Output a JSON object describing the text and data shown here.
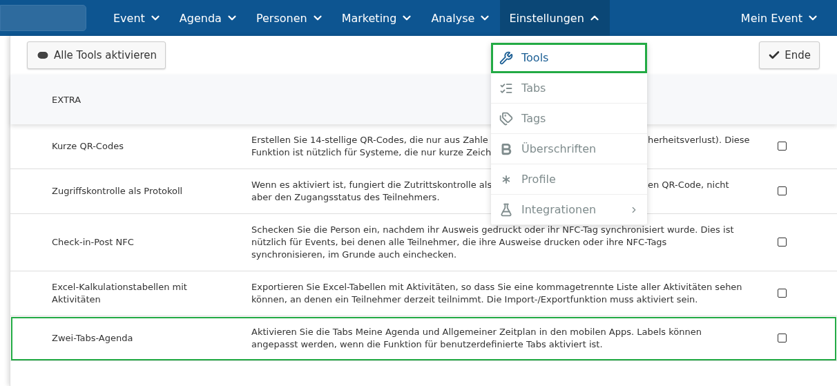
{
  "nav": {
    "items": [
      {
        "label": "Event",
        "expanded": false
      },
      {
        "label": "Agenda",
        "expanded": false
      },
      {
        "label": "Personen",
        "expanded": false
      },
      {
        "label": "Marketing",
        "expanded": false
      },
      {
        "label": "Analyse",
        "expanded": false
      },
      {
        "label": "Einstellungen",
        "expanded": true
      }
    ],
    "account": {
      "label": "Mein Event",
      "expanded": false
    }
  },
  "toolbar": {
    "enable_all": "Alle Tools aktivieren",
    "done": "Ende"
  },
  "table": {
    "section": "EXTRA",
    "rows": [
      {
        "name": "Kurze QR-Codes",
        "lines": [
          {
            "left": "Erstellen Sie 14-stellige QR-Codes, die nur aus Zahle",
            "right": "herheitsverlust). Diese"
          },
          {
            "left": "Funktion ist nützlich für Systeme, die nur kurze Zeich"
          }
        ],
        "checked": false,
        "highlighted": false
      },
      {
        "name": "Zugriffskontrolle als Protokoll",
        "lines": [
          {
            "left": "Wenn es aktiviert ist, fungiert die Zutrittskontrolle als",
            "right": "en QR-Code, nicht"
          },
          {
            "left": "aber den Zugangsstatus des Teilnehmers."
          }
        ],
        "checked": false,
        "highlighted": false
      },
      {
        "name": "Check-in-Post NFC",
        "description": "Schecken Sie die Person ein, nachdem ihr Ausweis gedruckt oder ihr NFC-Tag synchronisiert wurde. Dies ist nützlich für Events, bei denen alle Teilnehmer, die ihre Ausweise drucken oder ihre NFC-Tags synchronisieren, im Grunde auch einchecken.",
        "checked": false,
        "highlighted": false
      },
      {
        "name": "Excel-Kalkulationstabellen mit Aktivitäten",
        "description": "Exportieren Sie Excel-Tabellen mit Aktivitäten, so dass Sie eine kommagetrennte Liste aller Aktivitäten sehen können, an denen ein Teilnehmer derzeit teilnimmt. Die Import-/Exportfunktion muss aktiviert sein.",
        "checked": false,
        "highlighted": false
      },
      {
        "name": "Zwei-Tabs-Agenda",
        "description": "Aktivieren Sie die Tabs Meine Agenda und Allgemeiner Zeitplan in den mobilen Apps. Labels können angepasst werden, wenn die Funktion für benutzerdefinierte Tabs aktiviert ist.",
        "checked": false,
        "highlighted": true
      }
    ]
  },
  "menu": {
    "items": [
      {
        "kind": "wrench",
        "label": "Tools",
        "selected": true
      },
      {
        "kind": "list",
        "label": "Tabs",
        "selected": false
      },
      {
        "kind": "tags",
        "label": "Tags",
        "selected": false
      },
      {
        "kind": "bold",
        "label": "Überschriften",
        "selected": false
      },
      {
        "kind": "asterisk",
        "label": "Profile",
        "selected": false
      },
      {
        "kind": "flask",
        "label": "Integrationen",
        "selected": false,
        "submenu": true
      }
    ]
  }
}
